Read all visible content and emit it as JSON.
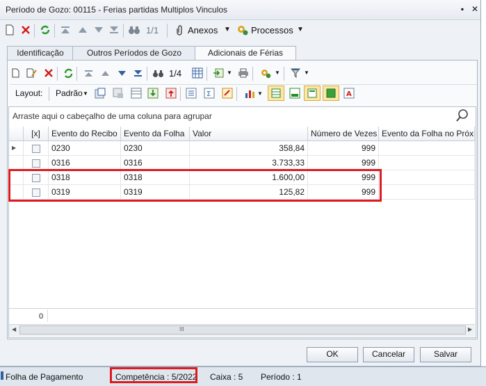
{
  "window": {
    "title": "Período de Gozo: 00115 - Ferias partidas Multiplos Vinculos",
    "pin_glyph": "▪",
    "close_glyph": "✕"
  },
  "main_toolbar": {
    "record_count": "1/1",
    "anexos_label": "Anexos",
    "processos_label": "Processos"
  },
  "tabs": [
    {
      "label": "Identificação"
    },
    {
      "label": "Outros Períodos de Gozo"
    },
    {
      "label": "Adicionais de Férias"
    }
  ],
  "grid_toolbar": {
    "record_count": "1/4",
    "layout_label": "Layout:",
    "padrao_label": "Padrão"
  },
  "grid": {
    "group_hint": "Arraste aqui o cabeçalho de uma coluna para agrupar",
    "columns": [
      "[x]",
      "Evento do Recibo",
      "Evento da Folha",
      "Valor",
      "Número de Vezes",
      "Evento da Folha no Próxmo"
    ],
    "rows": [
      {
        "recibo": "0230",
        "folha": "0230",
        "valor": "358,84",
        "vezes": "999"
      },
      {
        "recibo": "0316",
        "folha": "0316",
        "valor": "3.733,33",
        "vezes": "999"
      },
      {
        "recibo": "0318",
        "folha": "0318",
        "valor": "1.600,00",
        "vezes": "999"
      },
      {
        "recibo": "0319",
        "folha": "0319",
        "valor": "125,82",
        "vezes": "999"
      }
    ],
    "footer_count": "0",
    "scroll_grip": "III"
  },
  "buttons": {
    "ok": "OK",
    "cancel": "Cancelar",
    "save": "Salvar"
  },
  "status": {
    "module": "Folha de Pagamento",
    "competencia": "Competência : 5/2022",
    "caixa": "Caixa : 5",
    "periodo": "Período : 1"
  },
  "colors": {
    "highlight": "#e0191f",
    "accent": "#2f5f9e"
  },
  "icons": [
    "new-icon",
    "delete-icon",
    "refresh-icon",
    "first-icon",
    "prev-icon",
    "next-icon",
    "last-icon",
    "binoculars-icon",
    "paperclip-icon",
    "gear-icon",
    "dropdown-icon",
    "grid-icon",
    "import-icon",
    "print-icon",
    "filter-icon",
    "search-icon"
  ]
}
